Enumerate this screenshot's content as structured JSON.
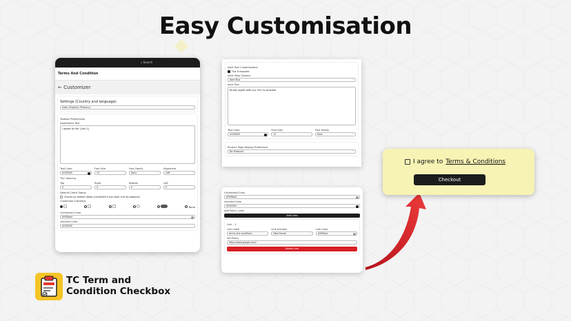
{
  "heading": "Easy Customisation",
  "brand": {
    "line1": "TC Term and",
    "line2": "Condition Checkbox"
  },
  "panel1": {
    "search": "Search",
    "app_title": "Terms And Condition",
    "back_title": "Customizer",
    "settings_title": "Settings (Country and language)",
    "language": "India (English) (Primary)",
    "textbox_prefs": "Textbox Preferences",
    "agreement_label": "Agreement Text",
    "agreement_text": "I agree to the {link-1}",
    "text_color_label": "Text Color",
    "text_color": "#000000",
    "font_size_label": "Font Size",
    "font_size": "12",
    "font_family_label": "Font Family",
    "font_family": "Sans",
    "alignment_label": "Alignment",
    "alignment": "Left",
    "spacing_label": "T&C Spacing",
    "top_label": "Top",
    "top": "0",
    "right_label": "Right",
    "right": "0",
    "bottom_label": "Bottom",
    "bottom": "0",
    "left_label": "Left",
    "left": "0",
    "unit": "Px",
    "default_status_label": "Default Check Status",
    "default_status_text": "Checks by default (Keep unchecked if you want it to be optional)",
    "customize_label": "Customize Checkbox",
    "none": "None",
    "unchecked_color_label": "Unchecked Color",
    "unchecked_color": "#909bad",
    "checked_color_label": "checked Color",
    "checked_color": "#000000"
  },
  "panel2": {
    "alert_title": "Alert Text Customization",
    "tick_required": "Tick it required",
    "alert_view_label": "Alert View Options",
    "alert_view": "Alert Box",
    "alert_text_label": "Alert Text",
    "alert_text": "Kindly agree with our T&C to proceed",
    "text_color_label": "Text Color",
    "text_color": "#000000",
    "font_size_label": "Font Size",
    "font_size": "12",
    "font_family_label": "Font Family",
    "font_family": "Sans",
    "product_pref_label": "Product Page Display Preference",
    "product_pref": "No Products"
  },
  "panel3": {
    "unchecked_label": "Unchecked Color",
    "unchecked": "#909bad",
    "checked_label": "checked Color",
    "checked": "#000000",
    "policy_links": "Add Policy Links",
    "add_links": "Add Links",
    "link_title": "Link - 1",
    "link_label_label": "Link Label",
    "link_label": "terms and conditions",
    "link_preview_label": "Link preview",
    "link_preview": "New frame",
    "link_color_label": "Link Color",
    "link_color": "#909bad",
    "set_policy_label": "Set Policy",
    "set_policy": "https://www.google.com/",
    "delete_link": "Delete Link"
  },
  "preview": {
    "agree_text": "I agree to",
    "link_text": "Terms & Conditions",
    "button": "Checkout"
  },
  "colors": {
    "accent_red": "#d71f26",
    "preview_bg": "#f7f3b4",
    "logo_yellow": "#f5c425"
  }
}
